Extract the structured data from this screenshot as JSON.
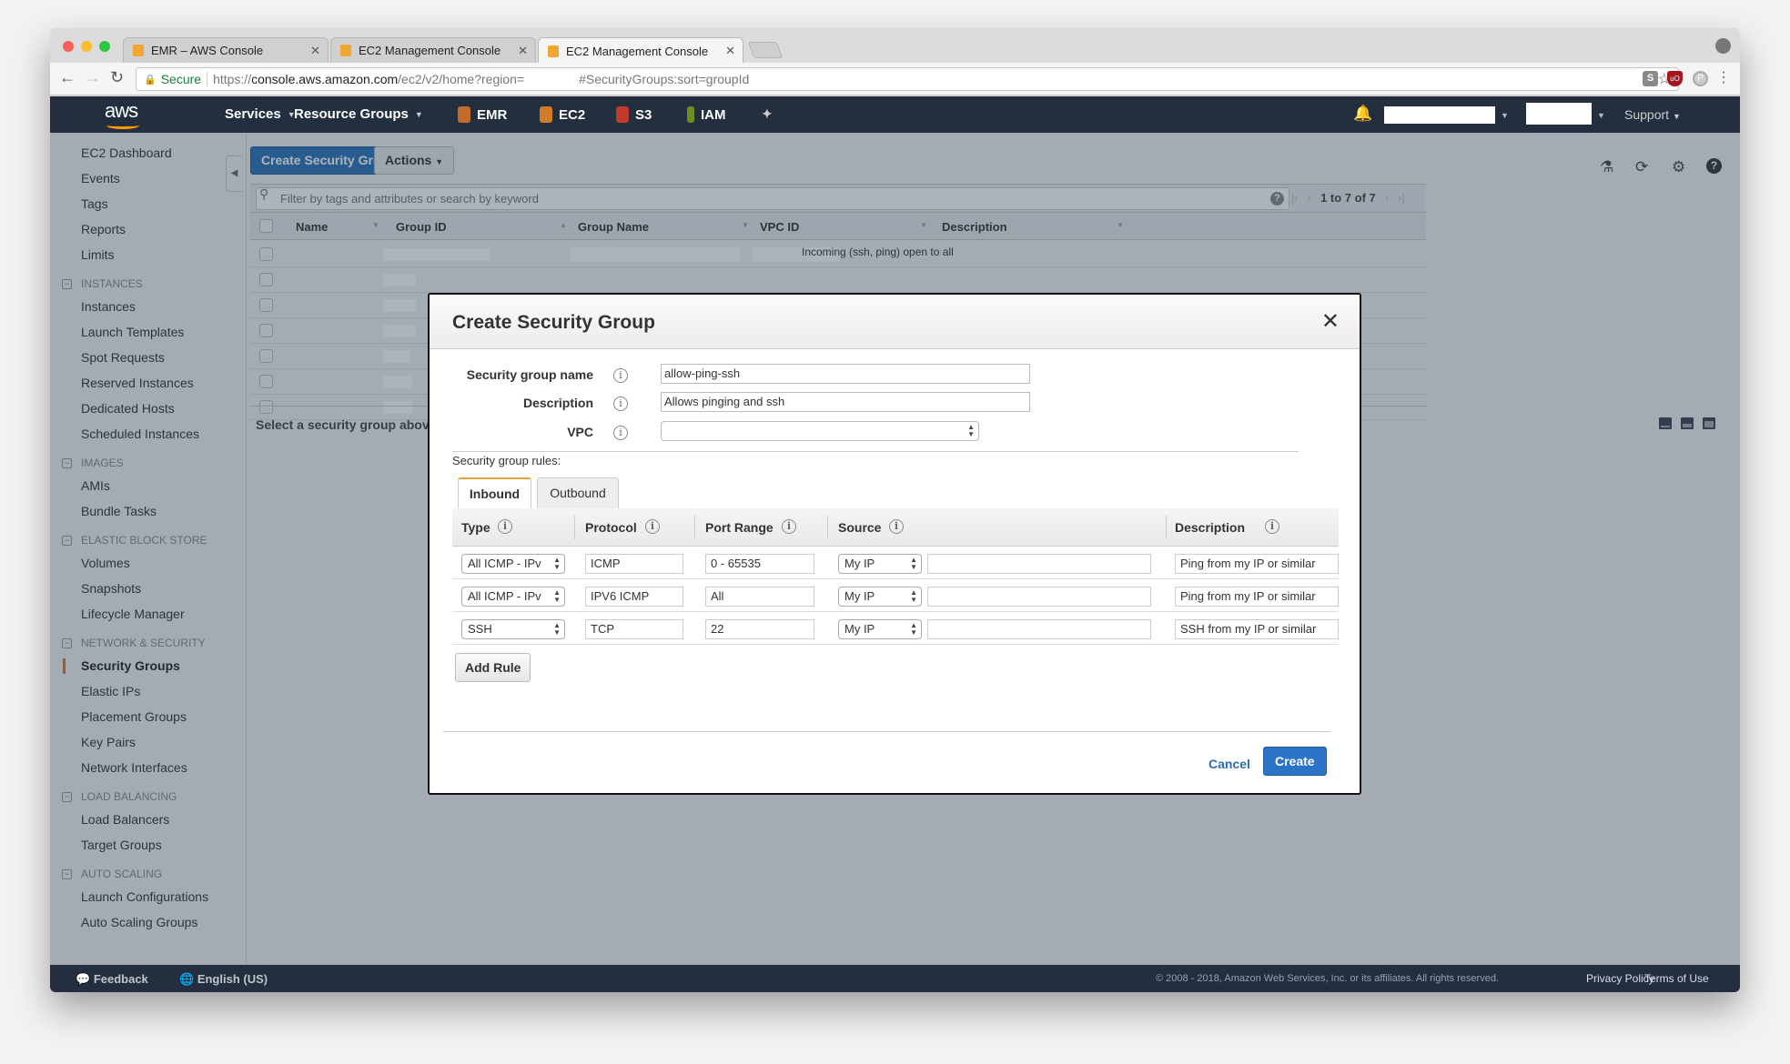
{
  "browser": {
    "tabs": [
      {
        "title": "EMR – AWS Console",
        "active": false
      },
      {
        "title": "EC2 Management Console",
        "active": false
      },
      {
        "title": "EC2 Management Console",
        "active": true
      }
    ],
    "address": {
      "secure_label": "Secure",
      "url_scheme": "https://",
      "url_host": "console.aws.amazon.com",
      "url_path": "/ec2/v2/home?region=",
      "url_hash": "#SecurityGroups:sort=groupId"
    },
    "extensions": [
      "S",
      "uO",
      "P"
    ]
  },
  "aws_nav": {
    "logo": "aws",
    "services": "Services",
    "resource_groups": "Resource Groups",
    "shortcuts": [
      {
        "label": "EMR",
        "color": "#c46a2b"
      },
      {
        "label": "EC2",
        "color": "#d07b2a"
      },
      {
        "label": "S3",
        "color": "#c0392b"
      },
      {
        "label": "IAM",
        "color": "#6b8e23"
      }
    ],
    "support": "Support"
  },
  "sidebar": {
    "top_items": [
      "EC2 Dashboard",
      "Events",
      "Tags",
      "Reports",
      "Limits"
    ],
    "sections": [
      {
        "title": "INSTANCES",
        "items": [
          "Instances",
          "Launch Templates",
          "Spot Requests",
          "Reserved Instances",
          "Dedicated Hosts",
          "Scheduled Instances"
        ]
      },
      {
        "title": "IMAGES",
        "items": [
          "AMIs",
          "Bundle Tasks"
        ]
      },
      {
        "title": "ELASTIC BLOCK STORE",
        "items": [
          "Volumes",
          "Snapshots",
          "Lifecycle Manager"
        ]
      },
      {
        "title": "NETWORK & SECURITY",
        "items": [
          "Security Groups",
          "Elastic IPs",
          "Placement Groups",
          "Key Pairs",
          "Network Interfaces"
        ]
      },
      {
        "title": "LOAD BALANCING",
        "items": [
          "Load Balancers",
          "Target Groups"
        ]
      },
      {
        "title": "AUTO SCALING",
        "items": [
          "Launch Configurations",
          "Auto Scaling Groups"
        ]
      }
    ],
    "active_item": "Security Groups"
  },
  "toolbar": {
    "create_label": "Create Security Group",
    "actions_label": "Actions"
  },
  "filter": {
    "placeholder": "Filter by tags and attributes or search by keyword",
    "pager": "1 to 7 of 7"
  },
  "grid": {
    "columns": [
      "Name",
      "Group ID",
      "Group Name",
      "VPC ID",
      "Description"
    ],
    "rows": [
      {
        "description": "Incoming (ssh, ping) open to all"
      },
      {
        "description": ""
      },
      {
        "description": ""
      },
      {
        "description": ""
      },
      {
        "description": ""
      },
      {
        "description": ""
      },
      {
        "description": ""
      }
    ]
  },
  "details_text": "Select a security group above",
  "footer": {
    "feedback": "Feedback",
    "language": "English (US)",
    "copyright": "© 2008 - 2018, Amazon Web Services, Inc. or its affiliates. All rights reserved.",
    "privacy": "Privacy Policy",
    "terms": "Terms of Use"
  },
  "modal": {
    "title": "Create Security Group",
    "fields": {
      "name_label": "Security group name",
      "name_value": "allow-ping-ssh",
      "desc_label": "Description",
      "desc_value": "Allows pinging and ssh",
      "vpc_label": "VPC",
      "vpc_value": ""
    },
    "rules_label": "Security group rules:",
    "tabs": [
      "Inbound",
      "Outbound"
    ],
    "active_tab": "Inbound",
    "rule_columns": [
      "Type",
      "Protocol",
      "Port Range",
      "Source",
      "Description"
    ],
    "rules": [
      {
        "type": "All ICMP - IPv",
        "protocol": "ICMP",
        "port": "0 - 65535",
        "source": "My IP",
        "cidr": "",
        "description": "Ping from my IP or similar"
      },
      {
        "type": "All ICMP - IPv",
        "protocol": "IPV6 ICMP",
        "port": "All",
        "source": "My IP",
        "cidr": "",
        "description": "Ping from my IP or similar"
      },
      {
        "type": "SSH",
        "protocol": "TCP",
        "port": "22",
        "source": "My IP",
        "cidr": "",
        "description": "SSH from my IP or similar"
      }
    ],
    "add_rule_label": "Add Rule",
    "cancel_label": "Cancel",
    "create_label": "Create"
  }
}
